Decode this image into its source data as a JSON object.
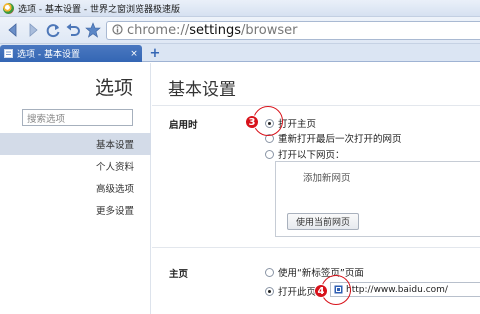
{
  "window": {
    "title": "选项 - 基本设置 - 世界之窗浏览器极速版"
  },
  "toolbar": {
    "url_prefix": "chrome://",
    "url_main": "settings",
    "url_suffix": "/browser"
  },
  "tabs": [
    {
      "label": "选项 - 基本设置",
      "close": "×"
    }
  ],
  "newtab_label": "+",
  "sidebar": {
    "title": "选项",
    "search_placeholder": "搜索选项",
    "items": [
      {
        "label": "基本设置"
      },
      {
        "label": "个人资料"
      },
      {
        "label": "高级选项"
      },
      {
        "label": "更多设置"
      }
    ]
  },
  "main": {
    "title": "基本设置",
    "startup": {
      "label": "启用时",
      "options": [
        {
          "label": "打开主页",
          "checked": true
        },
        {
          "label": "重新打开最后一次打开的网页",
          "checked": false
        },
        {
          "label": "打开以下网页：",
          "checked": false
        }
      ],
      "add_page": "添加新网页",
      "use_current": "使用当前网页"
    },
    "homepage": {
      "label": "主页",
      "options": [
        {
          "label": "使用“新标签页”页面",
          "checked": false
        },
        {
          "label": "打开此页：",
          "checked": true
        }
      ],
      "url": "http://www.baidu.com/"
    }
  },
  "callouts": {
    "first": "3",
    "second": "4"
  },
  "colors": {
    "tab_active": "#3466b4",
    "callout": "#d8121a",
    "nav_active": "#d3dbe8"
  }
}
